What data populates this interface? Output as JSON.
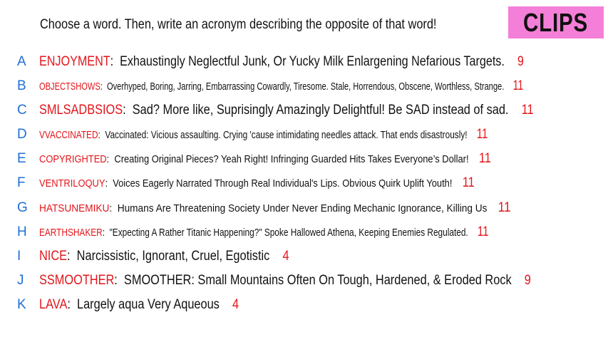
{
  "prompt": "Choose a word. Then, write an acronym describing the opposite of that word!",
  "logo": "CLIPS",
  "colors": {
    "letter": "#1f6fd6",
    "word": "#e3151a",
    "count": "#e3151a",
    "text": "#111111",
    "logo_bg": "#f47fd8"
  },
  "entries": [
    {
      "letter": "A",
      "word": "ENJOYMENT",
      "text": "Exhaustingly Neglectful Junk, Or Yucky Milk Enlargening Nefarious Targets.",
      "count": "9"
    },
    {
      "letter": "B",
      "word": "OBJECTSHOWS",
      "text": "Overhyped, Boring, Jarring, Embarrassing Cowardly, Tiresome. Stale, Horrendous, Obscene, Worthless, Strange.",
      "count": "11"
    },
    {
      "letter": "C",
      "word": "SMLSADBSIOS",
      "text": "Sad? More like, Suprisingly Amazingly Delightful! Be SAD instead of sad.",
      "count": "11"
    },
    {
      "letter": "D",
      "word": "VVACCINATED",
      "text": "Vaccinated: Vicious assaulting. Crying 'cause intimidating needles attack. That ends disastrously!",
      "count": "11"
    },
    {
      "letter": "E",
      "word": "COPYRIGHTED",
      "text": "Creating Original Pieces? Yeah Right! Infringing Guarded Hits Takes Everyone’s Dollar!",
      "count": "11"
    },
    {
      "letter": "F",
      "word": "VENTRILOQUY",
      "text": "Voices Eagerly Narrated Through Real Individual's Lips. Obvious Quirk Uplift Youth!",
      "count": "11"
    },
    {
      "letter": "G",
      "word": "HATSUNEMIKU",
      "text": "Humans Are Threatening Society Under Never Ending Mechanic Ignorance, Killing Us",
      "count": "11"
    },
    {
      "letter": "H",
      "word": "EARTHSHAKER",
      "text": "\"Expecting A Rather Titanic Happening?\" Spoke Hallowed Athena, Keeping Enemies Regulated.",
      "count": "11"
    },
    {
      "letter": "I",
      "word": "NICE",
      "text": "Narcissistic, Ignorant, Cruel, Egotistic",
      "count": "4"
    },
    {
      "letter": "J",
      "word": "SSMOOTHER",
      "text": "SMOOTHER: Small Mountains Often On Tough, Hardened, & Eroded Rock",
      "count": "9"
    },
    {
      "letter": "K",
      "word": "LAVA",
      "text": "Largely aqua Very Aqueous",
      "count": "4"
    }
  ]
}
